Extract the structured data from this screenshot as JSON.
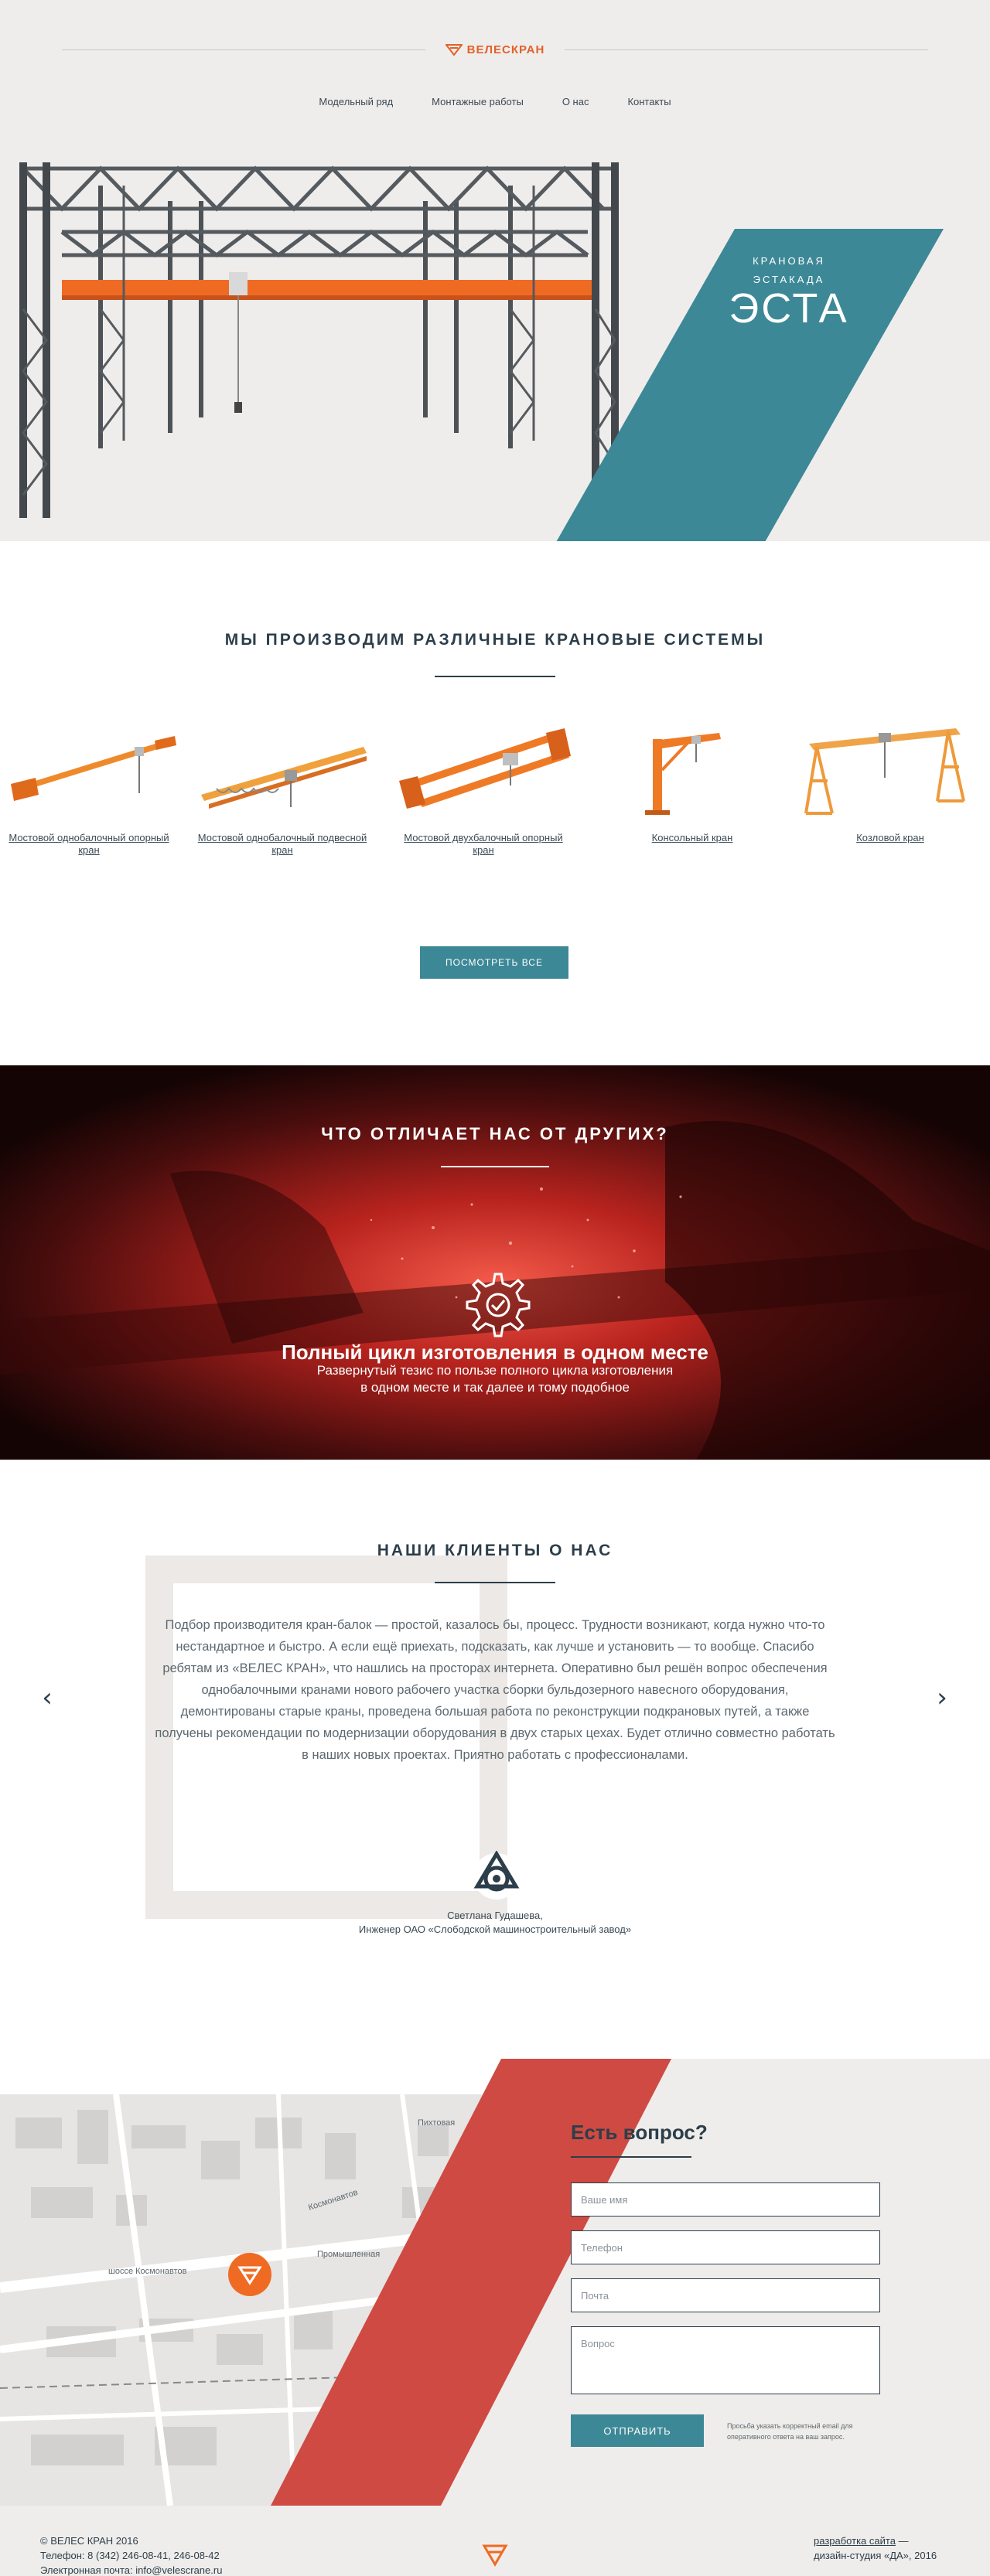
{
  "header": {
    "logo_text": "ВЕЛЕСКРАН",
    "nav": [
      "Модельный ряд",
      "Монтажные работы",
      "О нас",
      "Контакты"
    ]
  },
  "hero": {
    "subtitle_line1": "КРАНОВАЯ",
    "subtitle_line2": "ЭСТАКАДА",
    "title": "ЭСТА"
  },
  "products": {
    "title": "Мы производим различные крановые системы",
    "items": [
      {
        "label": "Мостовой однобалочный опорный кран",
        "icon": "single-girder-crane-icon"
      },
      {
        "label": "Мостовой однобалочный подвесной кран",
        "icon": "suspended-crane-icon"
      },
      {
        "label": "Мостовой двухбалочный опорный кран",
        "icon": "double-girder-crane-icon"
      },
      {
        "label": "Консольный кран",
        "icon": "jib-crane-icon"
      },
      {
        "label": "Козловой кран",
        "icon": "gantry-crane-icon"
      }
    ],
    "view_all": "ПОСМОТРЕТЬ ВСЕ"
  },
  "difference": {
    "title": "Что отличает нас от других?",
    "heading": "Полный цикл изготовления в одном месте",
    "text_line1": "Развернутый тезис по пользе полного цикла изготовления",
    "text_line2": "в одном месте и так далее и тому подобное"
  },
  "clients": {
    "title": "Наши клиенты о нас",
    "quote": "Подбор производителя кран-балок — простой, казалось бы, процесс. Трудности возникают, когда нужно что-то нестандартное и быстро. А если ещё приехать, подсказать, как лучше и установить — то вообще. Спасибо ребятам из «ВЕЛЕС КРАН», что нашлись на просторах интернета. Оперативно был решён вопрос обеспечения однобалочными кранами нового рабочего участка сборки бульдозерного навесного оборудования, демонтированы старые краны, проведена большая работа по реконструкции подкрановых путей, а также получены рекомендации по модернизации оборудования в двух старых цехах. Будет отлично совместно работать в наших новых проектах. Приятно работать с профессионалами.",
    "author": "Светлана Гудашева,",
    "position": "Инженер ОАО «Слободской машиностроительный завод»",
    "prev": "‹",
    "next": "›"
  },
  "contact": {
    "title": "Есть вопрос?",
    "name_placeholder": "Ваше имя",
    "phone_placeholder": "Телефон",
    "email_placeholder": "Почта",
    "question_placeholder": "Вопрос",
    "submit": "ОТПРАВИТЬ",
    "note": "Просьба указать корректный email для оперативного ответа на ваш запрос.",
    "map_labels": [
      "Пихтовая",
      "шоссе Космонавтов",
      "Космонавтов",
      "Промышленная"
    ]
  },
  "footer": {
    "copyright": "© ВЕЛЕС КРАН 2016",
    "phone": "Телефон: 8 (342) 246-08-41, 246-08-42",
    "email": "Электронная почта: info@velescrane.ru",
    "dev_link": "разработка сайта",
    "dev_suffix": " —",
    "studio": "дизайн-студия «ДА», 2016"
  },
  "colors": {
    "accent_orange": "#ef6b24",
    "teal": "#3d8896",
    "red": "#cf4a42",
    "dark": "#2c3e4a"
  }
}
